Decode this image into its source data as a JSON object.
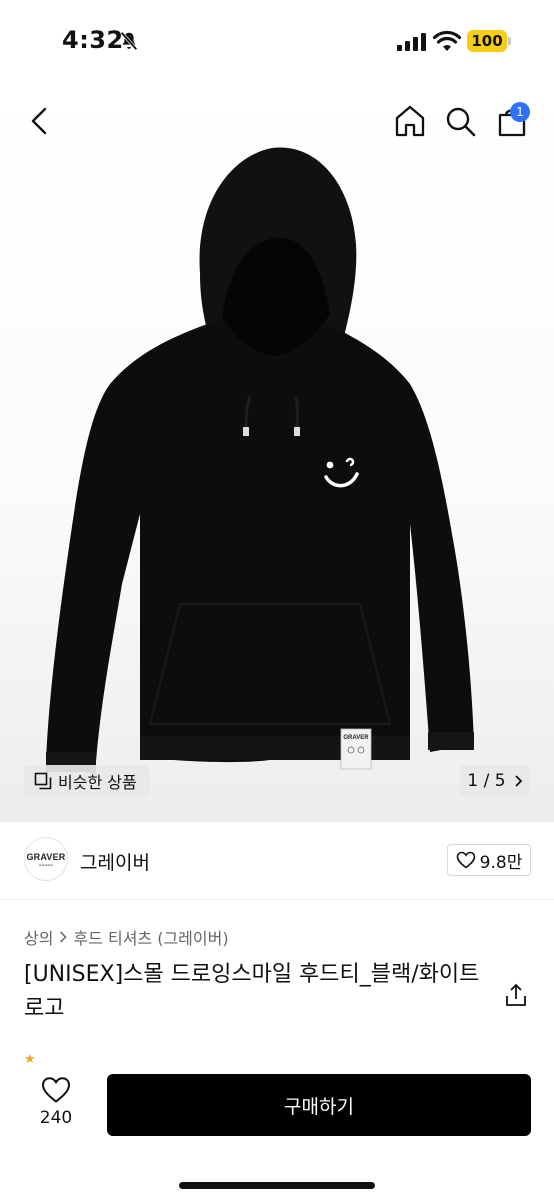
{
  "status_bar": {
    "time": "4:32",
    "battery": "100",
    "icons": [
      "bell-slash-icon",
      "signal-icon",
      "wifi-icon",
      "battery-icon"
    ]
  },
  "nav": {
    "icons": [
      "back-icon",
      "home-icon",
      "search-icon",
      "cart-icon"
    ],
    "cart_badge": "1",
    "badge_color": "#2f6ff5"
  },
  "gallery": {
    "similar_label": "비슷한 상품",
    "pager": "1 / 5",
    "garment_label": "GRAVER"
  },
  "brand": {
    "logo_text": "GRAVER",
    "name": "그레이버",
    "like_count": "9.8만"
  },
  "product": {
    "breadcrumb": [
      "상의",
      "후드 티셔츠 (그레이버)"
    ],
    "title": "[UNISEX]스몰 드로잉스마일 후드티_블랙/화이트 로고"
  },
  "bottom_bar": {
    "wish_count": "240",
    "buy_label": "구매하기",
    "accent": "#000000"
  }
}
